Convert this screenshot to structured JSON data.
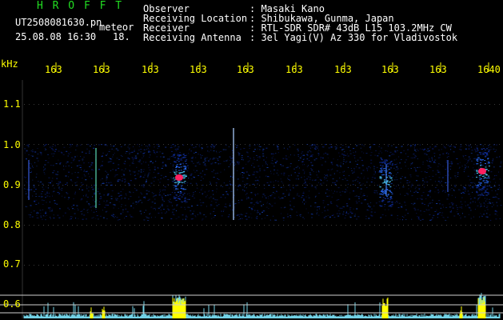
{
  "header": {
    "app_logo": "H R O F F T",
    "filename": "UT2508081630.pn",
    "meteor_label": "meteor",
    "datetime": "25.08.08 16:30",
    "count": "18.",
    "observer_label": "Observer",
    "observer_value": ": Masaki Kano",
    "location_label": "Receiving Location",
    "location_value": ": Shibukawa, Gunma, Japan",
    "receiver_label": "Receiver",
    "receiver_value": ": RTL-SDR SDR# 43dB L15 103.2MHz CW",
    "antenna_label": "Receiving Antenna",
    "antenna_value": ": 3el Yagi(V) Az 330 for Vladivostok"
  },
  "axes": {
    "y_unit": "kHz",
    "y_ticks": [
      "1.1",
      "1.0",
      "0.9",
      "0.8",
      "0.7",
      "0.6"
    ],
    "x_ticks": [
      "163",
      "163",
      "163",
      "163",
      "163",
      "163",
      "163",
      "163",
      "163",
      "1640"
    ]
  },
  "colors": {
    "background": "#000000",
    "header_text": "#ffffff",
    "logo": "#22dd22",
    "tick_labels": "#ffff00",
    "grid": "#ffffff",
    "signal_hot": "#ff2060",
    "power_trace": "#ffff00"
  }
}
